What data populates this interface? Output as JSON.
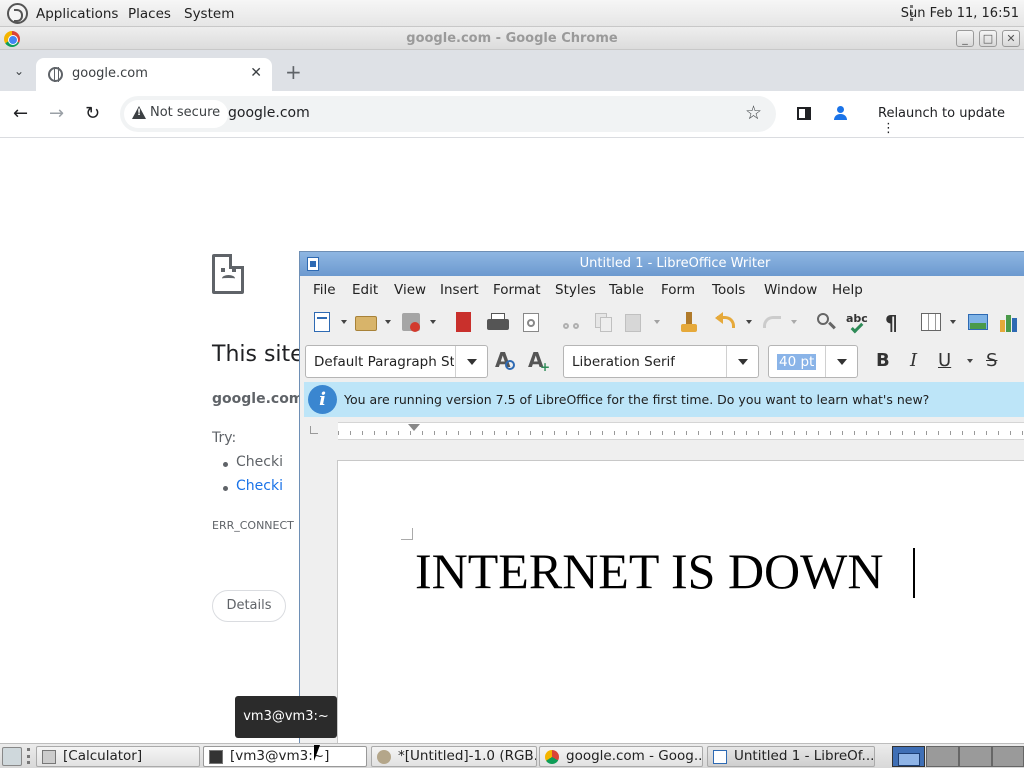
{
  "top_panel": {
    "menus": [
      "Applications",
      "Places",
      "System"
    ],
    "clock": "Sun Feb 11, 16:51"
  },
  "chrome": {
    "window_title": "google.com - Google Chrome",
    "tab_title": "google.com",
    "tab_close": "✕",
    "new_tab": "+",
    "tab_list": "⌄",
    "nav": {
      "back": "←",
      "forward": "→",
      "reload": "↻"
    },
    "security_label": "Not secure",
    "url": "google.com",
    "bookmark_star": "☆",
    "relaunch_label": "Relaunch to update",
    "relaunch_menu": "⋮",
    "error": {
      "heading": "This site",
      "host": "google.com",
      "try_label": "Try:",
      "suggestions": [
        "Checki",
        "Checki"
      ],
      "code": "ERR_CONNECT",
      "details_label": "Details"
    }
  },
  "writer": {
    "window_title": "Untitled 1 - LibreOffice Writer",
    "menus": [
      "File",
      "Edit",
      "View",
      "Insert",
      "Format",
      "Styles",
      "Table",
      "Form",
      "Tools",
      "Window",
      "Help"
    ],
    "paragraph_style": "Default Paragraph Sty",
    "font_name": "Liberation Serif",
    "font_size": "40 pt",
    "format_buttons": {
      "bold": "B",
      "italic": "I",
      "underline": "U",
      "strike": "S"
    },
    "infobar_text": "You are running version 7.5 of LibreOffice for the first time. Do you want to learn what's new?",
    "info_icon": "i",
    "document_text": "INTERNET IS DOWN"
  },
  "tooltip": "vm3@vm3:~",
  "taskbar": {
    "tasks": [
      {
        "label": "[Calculator]"
      },
      {
        "label": "[vm3@vm3:~]"
      },
      {
        "label": "*[Untitled]-1.0 (RGB..."
      },
      {
        "label": "google.com - Goog..."
      },
      {
        "label": "Untitled 1 - LibreOf..."
      }
    ]
  },
  "colors": {
    "lo_titlebar": "#7aa7da",
    "infobar": "#bde5f8",
    "chrome_tabstrip": "#dee1e6",
    "link": "#1a73e8"
  }
}
